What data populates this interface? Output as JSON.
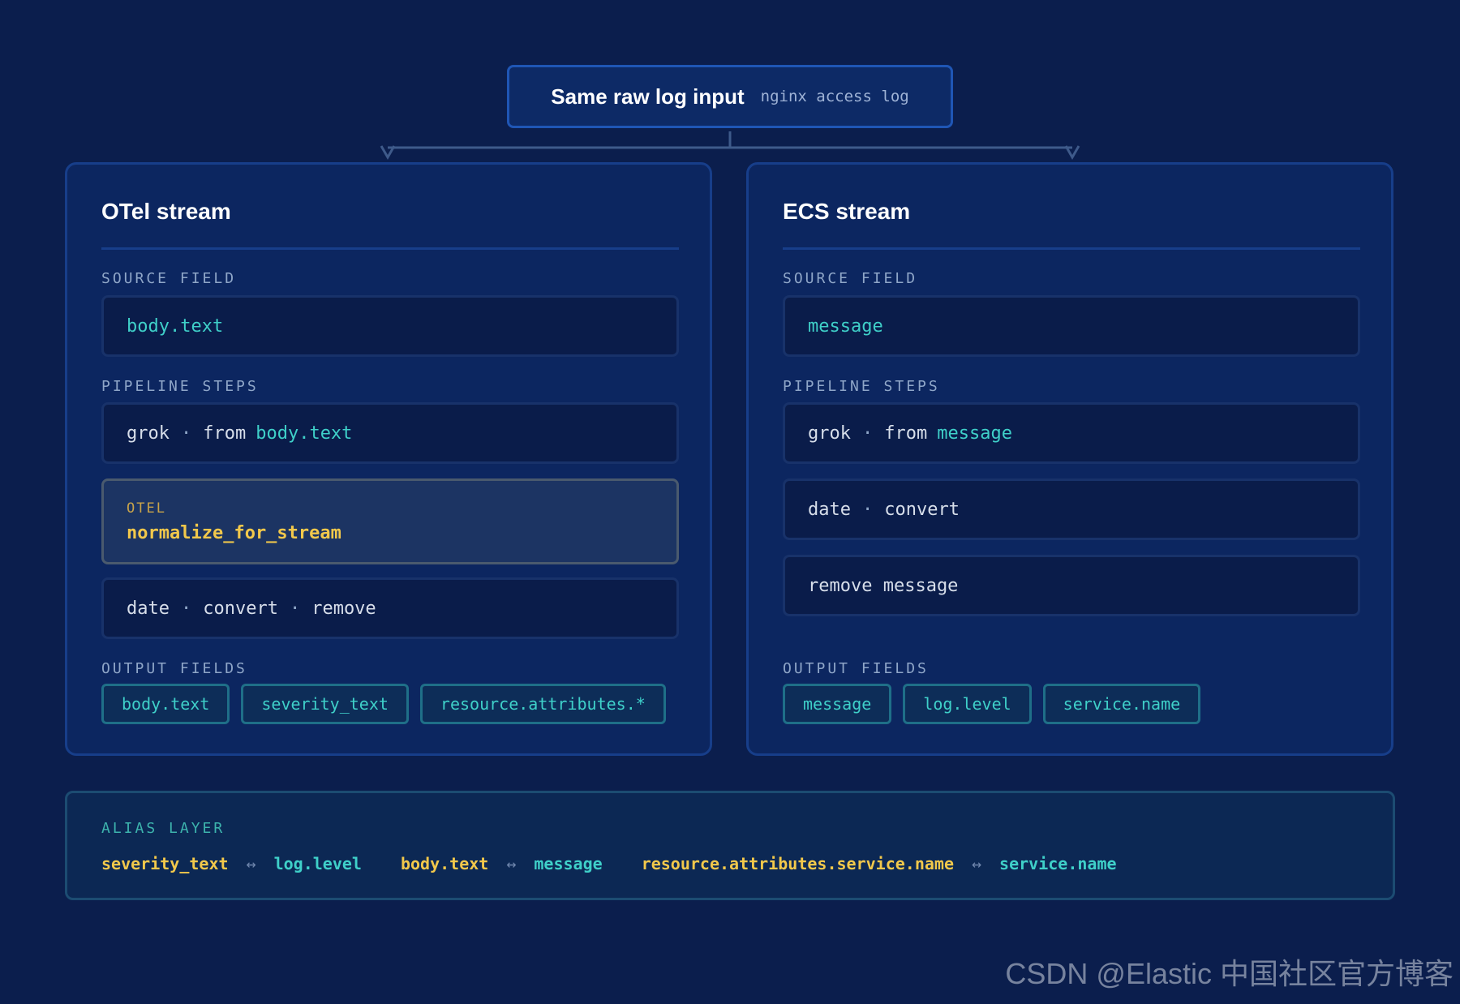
{
  "input": {
    "title": "Same raw log input",
    "subtitle": "nginx access log"
  },
  "labels": {
    "source_field": "SOURCE FIELD",
    "pipeline_steps": "PIPELINE STEPS",
    "output_fields": "OUTPUT FIELDS"
  },
  "otel": {
    "title": "OTel stream",
    "source": "body.text",
    "grok": {
      "name": "grok",
      "from": "from",
      "field": "body.text"
    },
    "normalize": {
      "tag": "OTEL",
      "name": "normalize_for_stream"
    },
    "post": {
      "a": "date",
      "b": "convert",
      "c": "remove"
    },
    "outputs": [
      "body.text",
      "severity_text",
      "resource.attributes.*"
    ]
  },
  "ecs": {
    "title": "ECS stream",
    "source": "message",
    "grok": {
      "name": "grok",
      "from": "from",
      "field": "message"
    },
    "date": {
      "a": "date",
      "b": "convert"
    },
    "remove": "remove message",
    "outputs": [
      "message",
      "log.level",
      "service.name"
    ]
  },
  "alias": {
    "label": "ALIAS LAYER",
    "pairs": [
      {
        "a": "severity_text",
        "arrow": "↔",
        "b": "log.level"
      },
      {
        "a": "body.text",
        "arrow": "↔",
        "b": "message"
      },
      {
        "a": "resource.attributes.service.name",
        "arrow": "↔",
        "b": "service.name"
      }
    ]
  },
  "separator": "·",
  "watermark": "CSDN @Elastic 中国社区官方博客"
}
